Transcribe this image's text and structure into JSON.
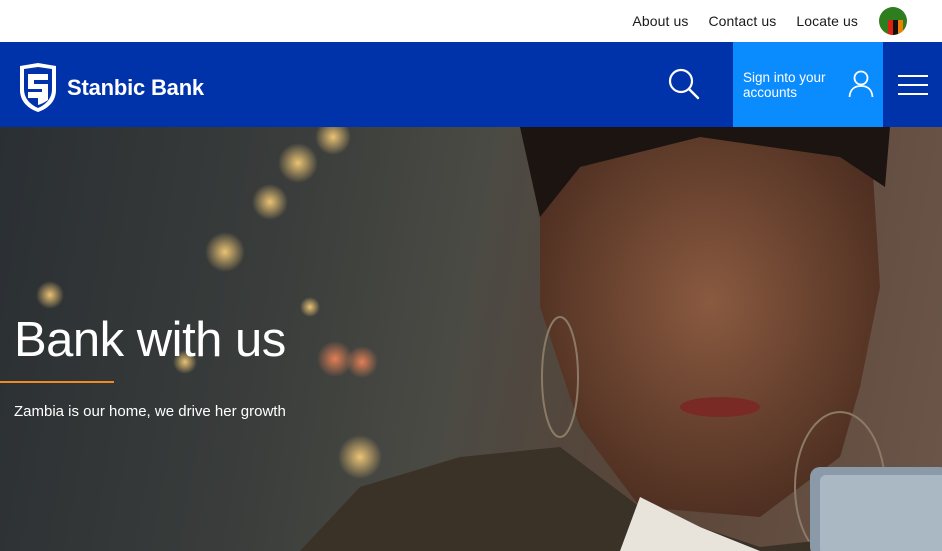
{
  "utility_nav": {
    "links": [
      "About us",
      "Contact us",
      "Locate us"
    ],
    "country_flag": "zambia-flag"
  },
  "header": {
    "brand_name": "Stanbic Bank",
    "search_icon": "search-icon",
    "signin_label": "Sign into your accounts",
    "user_icon": "user-icon",
    "menu_icon": "hamburger-menu-icon",
    "colors": {
      "header_bg": "#0033aa",
      "signin_bg": "#0a8cff"
    }
  },
  "hero": {
    "title": "Bank with us",
    "subtitle": "Zambia is our home, we drive her growth",
    "accent_color": "#f08a24"
  }
}
